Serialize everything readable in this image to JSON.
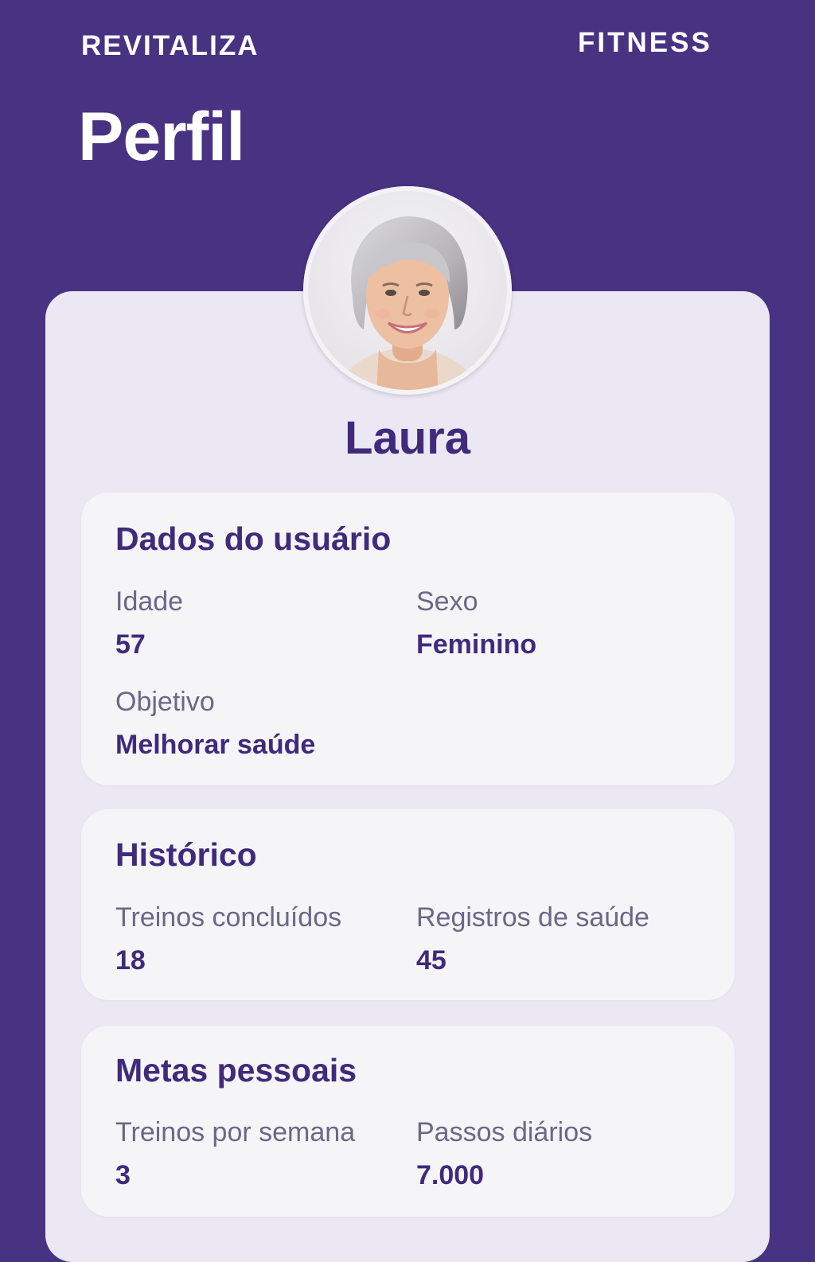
{
  "header": {
    "brand_left": "REVITALIZA",
    "brand_right": "FITNESS",
    "title": "Perfil"
  },
  "profile": {
    "name": "Laura"
  },
  "user_data": {
    "title": "Dados do usuário",
    "age_label": "Idade",
    "age_value": "57",
    "sex_label": "Sexo",
    "sex_value": "Feminino",
    "goal_label": "Objetivo",
    "goal_value": "Melhorar saúde"
  },
  "history": {
    "title": "Histórico",
    "workouts_label": "Treinos concluídos",
    "workouts_value": "18",
    "health_label": "Registros de saúde",
    "health_value": "45"
  },
  "goals": {
    "title": "Metas pessoais",
    "weekly_label": "Treinos por semana",
    "weekly_value": "3",
    "steps_label": "Passos diários",
    "steps_value": "7.000"
  },
  "colors": {
    "background": "#483282",
    "card": "#ece8f3",
    "section": "#f5f5f7",
    "accent_text": "#3f2a7c",
    "label_text": "#6b6788"
  }
}
